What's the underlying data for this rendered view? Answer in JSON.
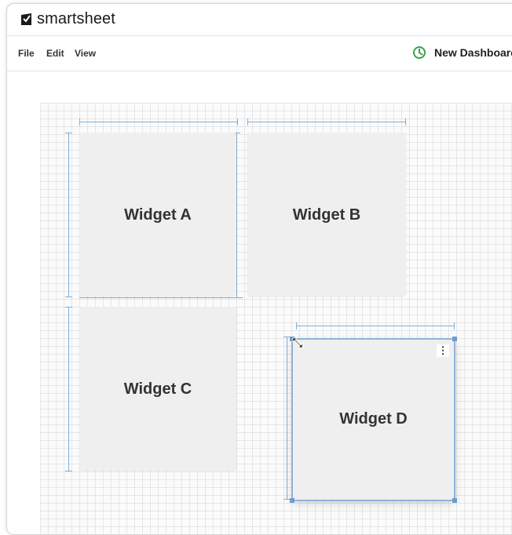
{
  "app": {
    "brand_name": "smartsheet"
  },
  "menu": {
    "items": [
      "File",
      "Edit",
      "View"
    ]
  },
  "dashboard": {
    "title": "New Dashboard"
  },
  "widgets": [
    {
      "label": "Widget A"
    },
    {
      "label": "Widget B"
    },
    {
      "label": "Widget C"
    },
    {
      "label": "Widget D"
    }
  ],
  "colors": {
    "guide": "#7fb0d8",
    "selection": "#6f9ccc",
    "widget_bg": "#efefef",
    "dashboard_icon": "#3aa14a"
  },
  "icons": [
    "smartsheet-logo-icon",
    "dashboard-icon",
    "kebab-menu-icon",
    "resize-cursor-icon"
  ]
}
